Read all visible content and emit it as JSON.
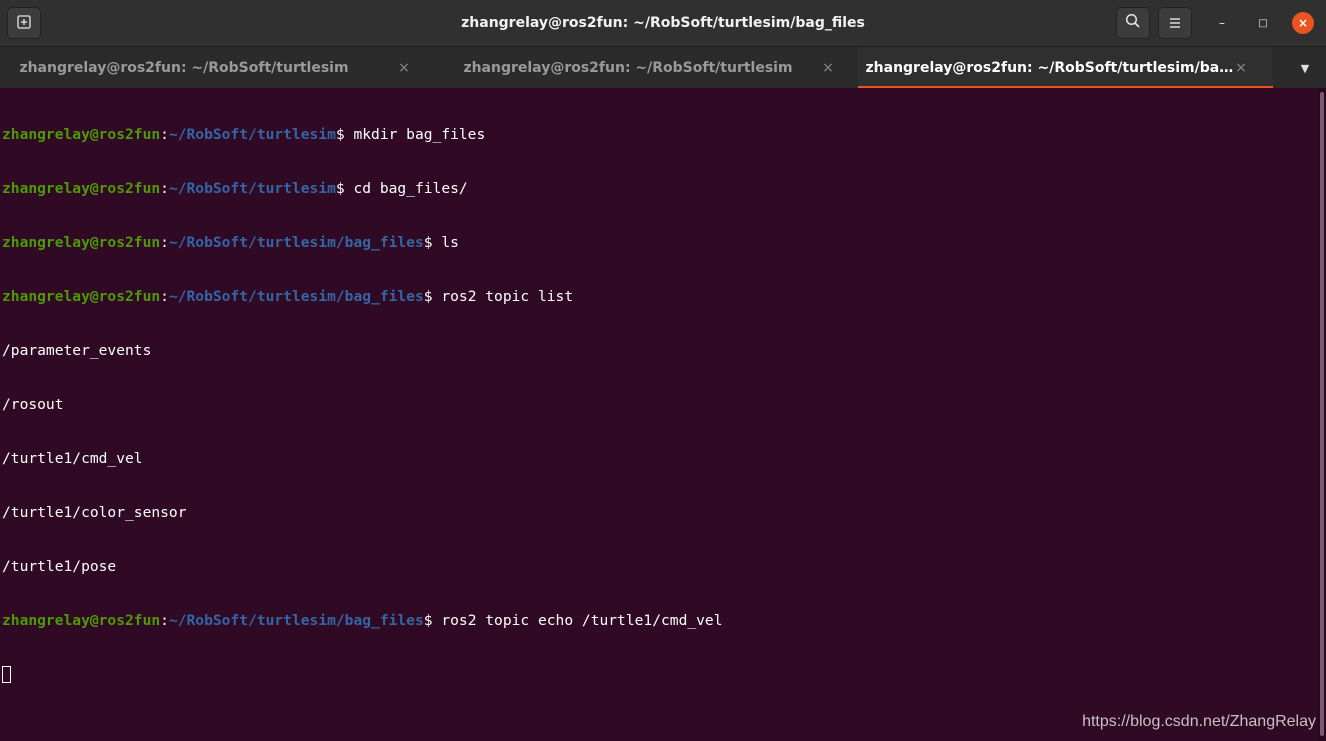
{
  "window": {
    "title": "zhangrelay@ros2fun: ~/RobSoft/turtlesim/bag_files",
    "new_tab_icon": "new-tab-icon",
    "search_icon": "search-icon",
    "menu_icon": "hamburger-menu-icon",
    "minimize_glyph": "–",
    "maximize_glyph": "□",
    "close_glyph": "×"
  },
  "tabs": [
    {
      "label": "zhangrelay@ros2fun: ~/RobSoft/turtlesim",
      "active": false
    },
    {
      "label": "zhangrelay@ros2fun: ~/RobSoft/turtlesim",
      "active": false
    },
    {
      "label": "zhangrelay@ros2fun: ~/RobSoft/turtlesim/bag_fi...",
      "active": true
    }
  ],
  "tab_close_glyph": "×",
  "tab_menu_glyph": "▼",
  "terminal": {
    "lines": [
      {
        "kind": "prompt",
        "user": "zhangrelay@ros2fun",
        "colon": ":",
        "path": "~/RobSoft/turtlesim",
        "cmd": "$ mkdir bag_files"
      },
      {
        "kind": "prompt",
        "user": "zhangrelay@ros2fun",
        "colon": ":",
        "path": "~/RobSoft/turtlesim",
        "cmd": "$ cd bag_files/"
      },
      {
        "kind": "prompt",
        "user": "zhangrelay@ros2fun",
        "colon": ":",
        "path": "~/RobSoft/turtlesim/bag_files",
        "cmd": "$ ls"
      },
      {
        "kind": "prompt",
        "user": "zhangrelay@ros2fun",
        "colon": ":",
        "path": "~/RobSoft/turtlesim/bag_files",
        "cmd": "$ ros2 topic list"
      },
      {
        "kind": "output",
        "text": "/parameter_events"
      },
      {
        "kind": "output",
        "text": "/rosout"
      },
      {
        "kind": "output",
        "text": "/turtle1/cmd_vel"
      },
      {
        "kind": "output",
        "text": "/turtle1/color_sensor"
      },
      {
        "kind": "output",
        "text": "/turtle1/pose"
      },
      {
        "kind": "prompt",
        "user": "zhangrelay@ros2fun",
        "colon": ":",
        "path": "~/RobSoft/turtlesim/bag_files",
        "cmd": "$ ros2 topic echo /turtle1/cmd_vel"
      }
    ],
    "colors": {
      "background": "#300a24",
      "user": "#4e9a06",
      "path": "#3465a4",
      "text": "#ffffff"
    }
  },
  "watermark": "https://blog.csdn.net/ZhangRelay",
  "accent": "#e95420"
}
